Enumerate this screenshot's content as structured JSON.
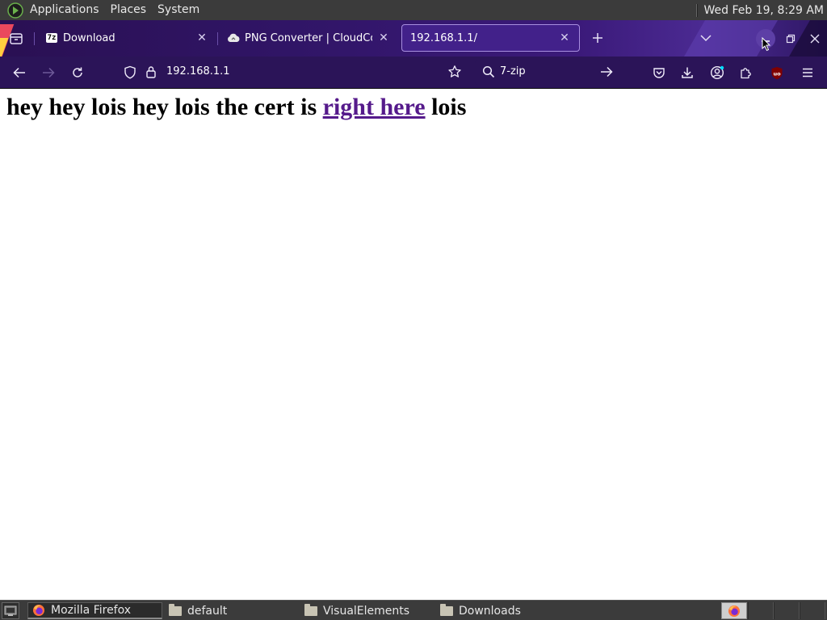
{
  "top_panel": {
    "menus": [
      "Applications",
      "Places",
      "System"
    ],
    "clock": "Wed Feb 19,  8:29 AM",
    "os_icon": "os-logo-icon"
  },
  "browser": {
    "tabs": [
      {
        "title": "Download",
        "favicon": "7z",
        "active": false
      },
      {
        "title": "PNG Converter | CloudConvert",
        "favicon": "cloud-icon",
        "active": false
      },
      {
        "title": "192.168.1.1/",
        "favicon": "",
        "active": true
      }
    ],
    "url": "192.168.1.1",
    "search_text": "7-zip",
    "colors": {
      "tabstrip": "#2f1566",
      "navbar": "#2b1458",
      "active_tab": "#42218a",
      "link": "#551a8b"
    }
  },
  "page": {
    "heading_before": "hey hey lois hey lois the cert is ",
    "link_text": "right here",
    "heading_after": " lois"
  },
  "taskbar": {
    "tasks": [
      {
        "label": "Mozilla Firefox",
        "icon": "firefox-icon",
        "active": true
      },
      {
        "label": "default",
        "icon": "folder-icon",
        "active": false
      },
      {
        "label": "VisualElements",
        "icon": "folder-icon",
        "active": false
      },
      {
        "label": "Downloads",
        "icon": "folder-icon",
        "active": false
      }
    ]
  }
}
